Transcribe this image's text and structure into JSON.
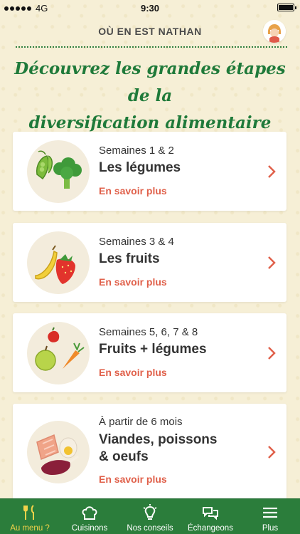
{
  "status": {
    "carrier": "4G",
    "time": "9:30"
  },
  "header": {
    "title": "OÙ EN EST NATHAN"
  },
  "headline": {
    "line1": "Découvrez les grandes étapes de la",
    "line2": "diversification alimentaire"
  },
  "cards": [
    {
      "period": "Semaines 1 & 2",
      "name": "Les légumes",
      "more": "En savoir plus",
      "thumb_icon": "peas-broccoli-icon"
    },
    {
      "period": "Semaines 3 & 4",
      "name": "Les fruits",
      "more": "En savoir plus",
      "thumb_icon": "banana-strawberry-icon"
    },
    {
      "period": "Semaines 5, 6, 7 & 8",
      "name": "Fruits + légumes",
      "more": "En savoir plus",
      "thumb_icon": "apple-carrot-pepper-icon"
    },
    {
      "period": "À partir de 6 mois",
      "name_line1": "Viandes, poissons",
      "name_line2": "& oeufs",
      "more": "En savoir plus",
      "thumb_icon": "meat-fish-egg-icon"
    }
  ],
  "tabs": [
    {
      "label": "Au menu ?",
      "icon": "fork-knife-icon",
      "active": true
    },
    {
      "label": "Cuisinons",
      "icon": "chef-hat-icon",
      "active": false
    },
    {
      "label": "Nos conseils",
      "icon": "lightbulb-icon",
      "active": false
    },
    {
      "label": "Échangeons",
      "icon": "chat-bubbles-icon",
      "active": false
    },
    {
      "label": "Plus",
      "icon": "menu-icon",
      "active": false
    }
  ],
  "colors": {
    "brand_green": "#2b7d3b",
    "headline_green": "#1f7a3a",
    "link_red": "#e0604a",
    "active_tab": "#f3d24a",
    "background": "#f6efd6"
  }
}
